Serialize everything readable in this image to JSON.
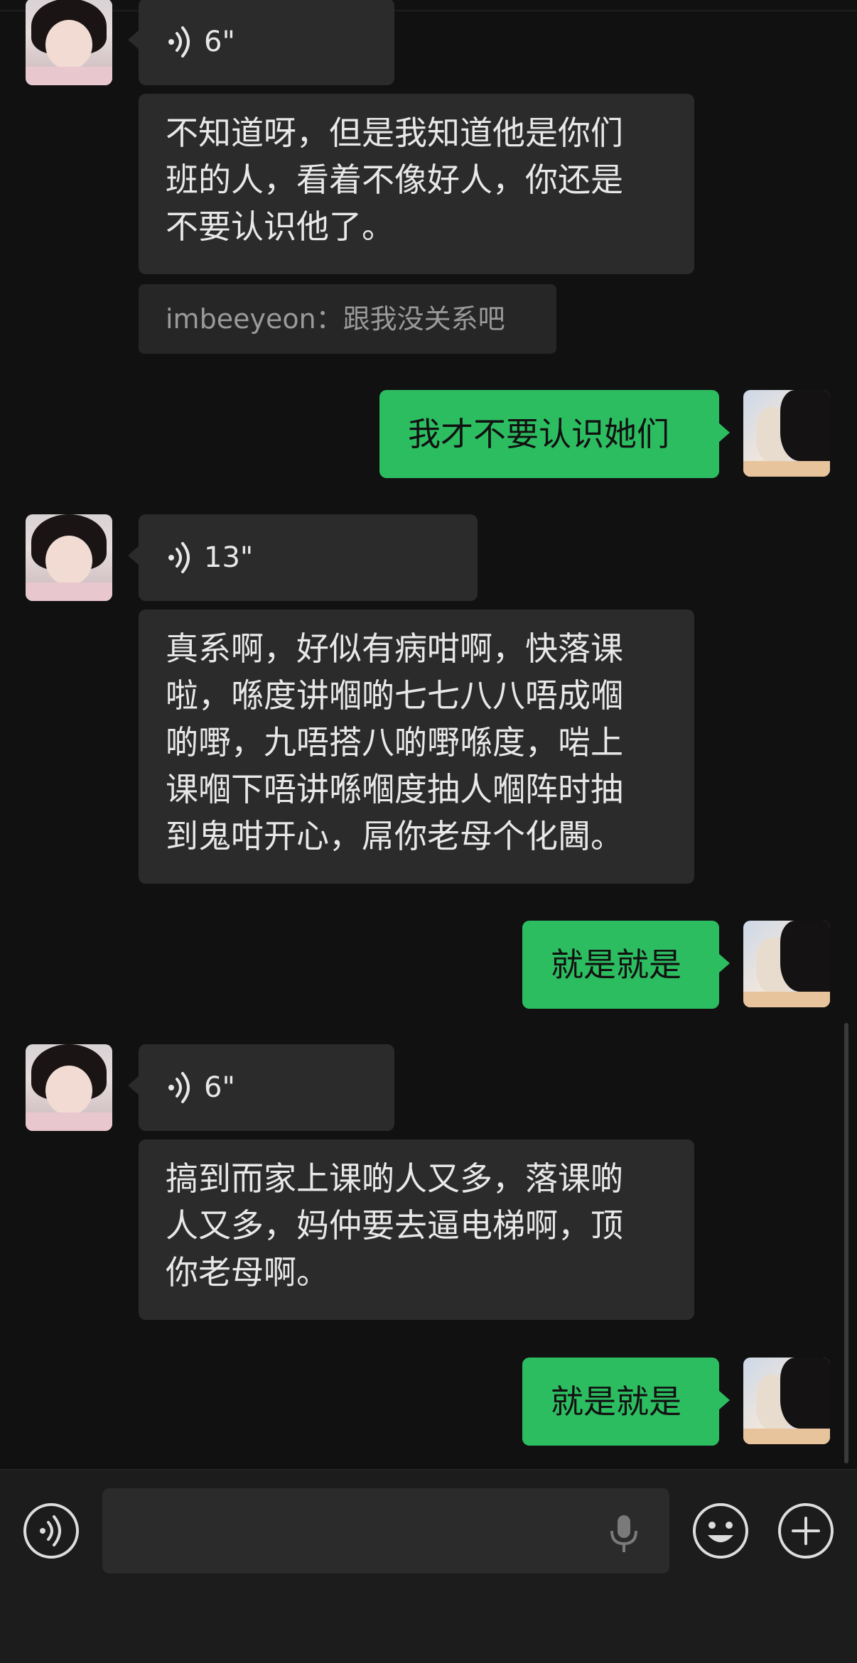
{
  "messages": [
    {
      "from": "other",
      "type": "voice",
      "duration": "6\""
    },
    {
      "from": "other",
      "type": "text",
      "lines": [
        "不知道呀，但是我知道他是你们",
        "班的人，看着不像好人，你还是",
        "不要认识他了。"
      ]
    },
    {
      "from": "other",
      "type": "quote",
      "text": "imbeeyeon：跟我没关系吧"
    },
    {
      "from": "me",
      "type": "text",
      "text": "我才不要认识她们"
    },
    {
      "from": "other",
      "type": "voice",
      "duration": "13\""
    },
    {
      "from": "other",
      "type": "text",
      "lines": [
        "真系啊，好似有病咁啊，快落课",
        "啦，喺度讲嗰啲七七八八唔成嗰",
        "啲嘢，九唔搭八啲嘢喺度，啱上",
        "课嗰下唔讲喺嗰度抽人嗰阵时抽",
        "到鬼咁开心，屌你老母个化閪。"
      ]
    },
    {
      "from": "me",
      "type": "text",
      "text": "就是就是"
    },
    {
      "from": "other",
      "type": "voice",
      "duration": "6\""
    },
    {
      "from": "other",
      "type": "text",
      "lines": [
        "搞到而家上课啲人又多，落课啲",
        "人又多，妈仲要去逼电梯啊，顶",
        "你老母啊。"
      ]
    },
    {
      "from": "me",
      "type": "text",
      "text": "就是就是"
    }
  ],
  "input": {
    "placeholder": ""
  },
  "colors": {
    "background": "#111111",
    "bubble_other": "#2b2b2b",
    "bubble_me": "#2dbd61"
  }
}
